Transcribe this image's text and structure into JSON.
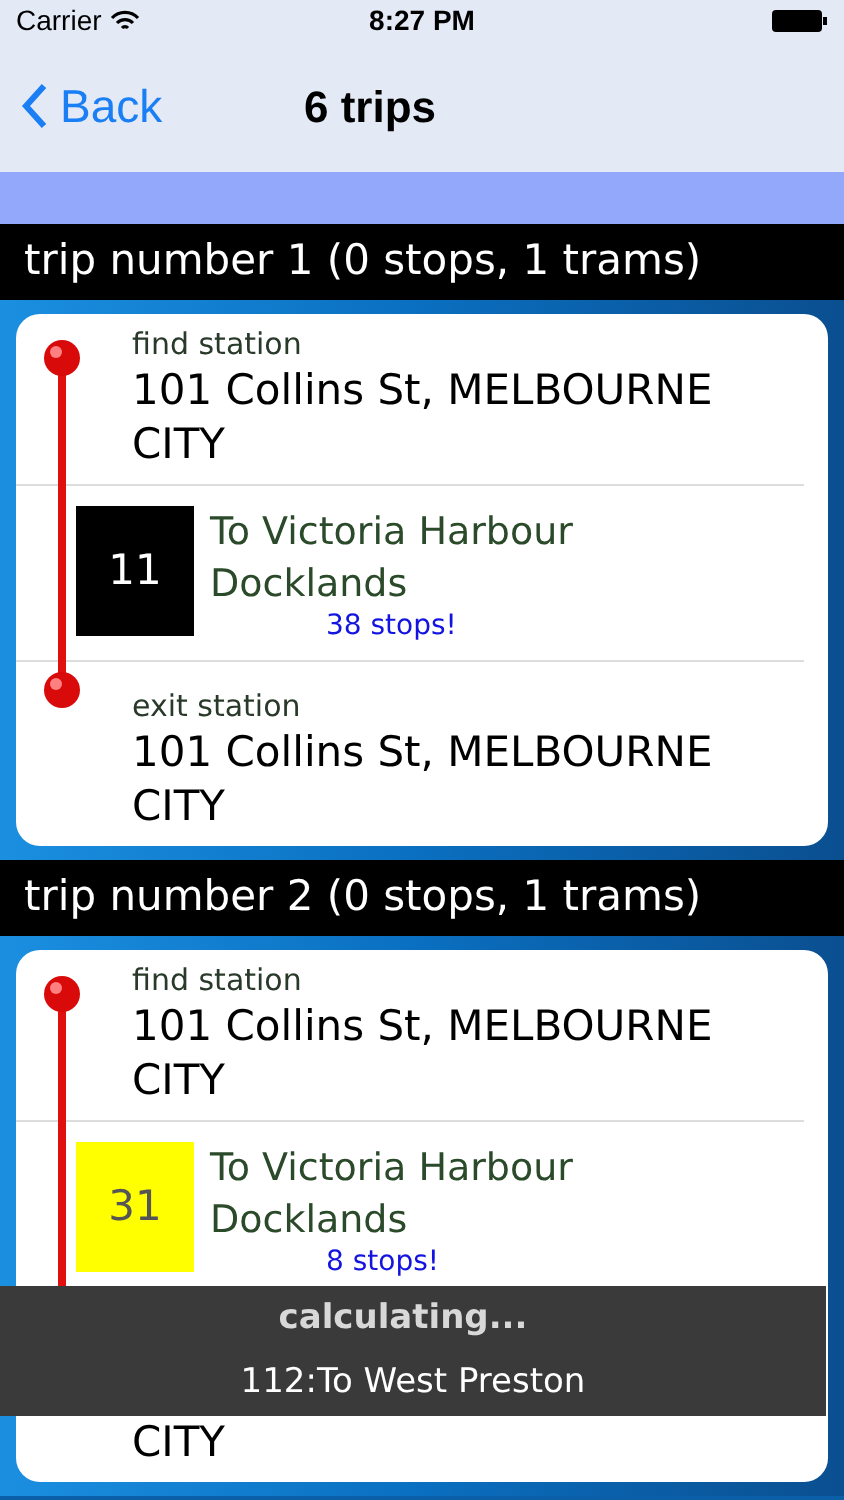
{
  "status_bar": {
    "carrier": "Carrier",
    "time": "8:27 PM"
  },
  "nav": {
    "back": "Back",
    "title": "6 trips"
  },
  "trips": [
    {
      "header": "trip number 1 (0 stops, 1 trams)",
      "find_label": "find station",
      "find_station": "101 Collins St, MELBOURNE CITY",
      "tram": {
        "number": "11",
        "color": "#000000",
        "destination": "To Victoria Harbour Docklands",
        "stops": "38 stops!"
      },
      "exit_label": "exit station",
      "exit_station": "101 Collins St, MELBOURNE CITY"
    },
    {
      "header": "trip number 2 (0 stops, 1 trams)",
      "find_label": "find station",
      "find_station": "101 Collins St, MELBOURNE CITY",
      "tram": {
        "number": "31",
        "color": "#ffff00",
        "destination": "To Victoria Harbour Docklands",
        "stops": "8 stops!"
      },
      "exit_station": "CITY"
    }
  ],
  "overlay": {
    "title": "calculating...",
    "detail": "112:To West Preston"
  }
}
